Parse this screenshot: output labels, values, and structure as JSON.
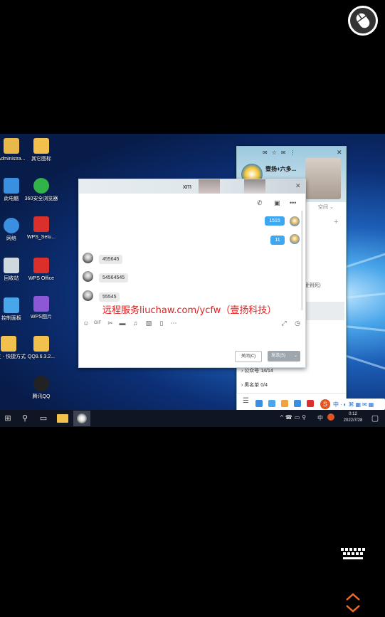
{
  "desktop": {
    "icons": [
      {
        "label": "Administra...",
        "icon": "user-folder-icon",
        "color": "#e8b94a"
      },
      {
        "label": "其它图标",
        "icon": "folder-icon",
        "color": "#f1c04d"
      },
      {
        "label": "此电脑",
        "icon": "computer-icon",
        "color": "#3a8fe0"
      },
      {
        "label": "360安全浏览器",
        "icon": "browser-360-icon",
        "color": "#32b34a"
      },
      {
        "label": "网络",
        "icon": "network-icon",
        "color": "#3a8fe0"
      },
      {
        "label": "WPS_Setu...",
        "icon": "wps-setup-icon",
        "color": "#d9302c"
      },
      {
        "label": "回收站",
        "icon": "recycle-bin-icon",
        "color": "#cfd8de"
      },
      {
        "label": "WPS Office",
        "icon": "wps-office-icon",
        "color": "#d9302c"
      },
      {
        "label": "控制面板",
        "icon": "control-panel-icon",
        "color": "#4aa6ea"
      },
      {
        "label": "WPS图片",
        "icon": "wps-picture-icon",
        "color": "#8c58d6"
      },
      {
        "label": "文三 - 快捷方式",
        "icon": "shortcut-folder-icon",
        "color": "#f1c04d"
      },
      {
        "label": "QQ9.6.3.2...",
        "icon": "qq-installer-icon",
        "color": "#f1c04d"
      },
      {
        "label": "腾讯QQ",
        "icon": "qq-penguin-icon",
        "color": "#222222"
      }
    ]
  },
  "chat": {
    "title": "xm",
    "messages_out": [
      "1515",
      "11"
    ],
    "messages_in": [
      "455645",
      "54564545",
      "55545"
    ],
    "close_label": "关闭(C)",
    "send_label": "发送(S)"
  },
  "qq_main": {
    "profile_name": "壹扬+六多...",
    "space_label": "空间",
    "status_text": "(爱到死)",
    "group_public": "公众号 14/14",
    "group_blacklist": "黑名单 0/4"
  },
  "watermark": "远程服务liuchaw.com/ycfw（壹扬科技）",
  "taskbar": {
    "time": "0:12",
    "date": "2022/7/28",
    "ime": "中"
  },
  "colors": {
    "accent": "#3ea7f2",
    "watermark": "#e21d1d"
  }
}
